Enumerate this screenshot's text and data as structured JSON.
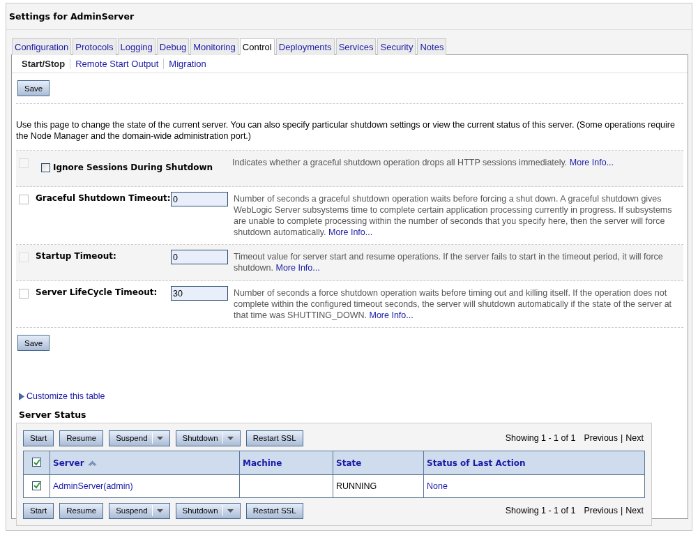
{
  "window": {
    "title": "Settings for AdminServer"
  },
  "tabs": [
    {
      "label": "Configuration",
      "selected": false
    },
    {
      "label": "Protocols",
      "selected": false
    },
    {
      "label": "Logging",
      "selected": false
    },
    {
      "label": "Debug",
      "selected": false
    },
    {
      "label": "Monitoring",
      "selected": false
    },
    {
      "label": "Control",
      "selected": true
    },
    {
      "label": "Deployments",
      "selected": false
    },
    {
      "label": "Services",
      "selected": false
    },
    {
      "label": "Security",
      "selected": false
    },
    {
      "label": "Notes",
      "selected": false
    }
  ],
  "subtabs": [
    {
      "label": "Start/Stop",
      "selected": true
    },
    {
      "label": "Remote Start Output",
      "selected": false
    },
    {
      "label": "Migration",
      "selected": false
    }
  ],
  "save_button": "Save",
  "description": "Use this page to change the state of the current server. You can also specify particular shutdown settings or view the current status of this server. (Some operations require the Node Manager and the domain-wide administration port.)",
  "settings": [
    {
      "kind": "checkbox",
      "label": "Ignore Sessions During Shutdown",
      "checked": false,
      "change_disabled": true,
      "help": "Indicates whether a graceful shutdown operation drops all HTTP sessions immediately.",
      "more_info": "More Info..."
    },
    {
      "kind": "text",
      "label": "Graceful Shutdown Timeout:",
      "value": "0",
      "change_disabled": false,
      "help": "Number of seconds a graceful shutdown operation waits before forcing a shut down. A graceful shutdown gives WebLogic Server subsystems time to complete certain application processing currently in progress. If subsystems are unable to complete processing within the number of seconds that you specify here, then the server will force shutdown automatically.",
      "more_info": "More Info..."
    },
    {
      "kind": "text",
      "label": "Startup Timeout:",
      "value": "0",
      "change_disabled": true,
      "help": "Timeout value for server start and resume operations. If the server fails to start in the timeout period, it will force shutdown.",
      "more_info": "More Info..."
    },
    {
      "kind": "text",
      "label": "Server LifeCycle Timeout:",
      "value": "30",
      "change_disabled": false,
      "help": "Number of seconds a force shutdown operation waits before timing out and killing itself. If the operation does not complete within the configured timeout seconds, the server will shutdown automatically if the state of the server at that time was SHUTTING_DOWN.",
      "more_info": "More Info..."
    }
  ],
  "save_button_bottom": "Save",
  "customize_link": "Customize this table",
  "server_status": {
    "title": "Server Status",
    "top_actions": [
      {
        "label": "Start",
        "kind": "button"
      },
      {
        "label": "Resume",
        "kind": "button"
      },
      {
        "label": "Suspend",
        "kind": "dropdown"
      },
      {
        "label": "Shutdown",
        "kind": "dropdown"
      },
      {
        "label": "Restart SSL",
        "kind": "button"
      }
    ],
    "top_pager": {
      "showing": "Showing 1 - 1 of 1",
      "previous": "Previous",
      "separator": "|",
      "next": "Next"
    },
    "table": {
      "select_all_checked": true,
      "columns": [
        {
          "label": "Server",
          "sorted": true
        },
        {
          "label": "Machine",
          "sorted": false
        },
        {
          "label": "State",
          "sorted": false
        },
        {
          "label": "Status of Last Action",
          "sorted": false
        }
      ],
      "rows": [
        {
          "checked": true,
          "server": "AdminServer(admin)",
          "machine": "",
          "state": "RUNNING",
          "last_action": "None"
        }
      ]
    },
    "bottom_actions": [
      {
        "label": "Start",
        "kind": "button"
      },
      {
        "label": "Resume",
        "kind": "button"
      },
      {
        "label": "Suspend",
        "kind": "dropdown"
      },
      {
        "label": "Shutdown",
        "kind": "dropdown"
      },
      {
        "label": "Restart SSL",
        "kind": "button"
      }
    ],
    "bottom_pager": {
      "showing": "Showing 1 - 1 of 1",
      "previous": "Previous",
      "separator": "|",
      "next": "Next"
    }
  }
}
